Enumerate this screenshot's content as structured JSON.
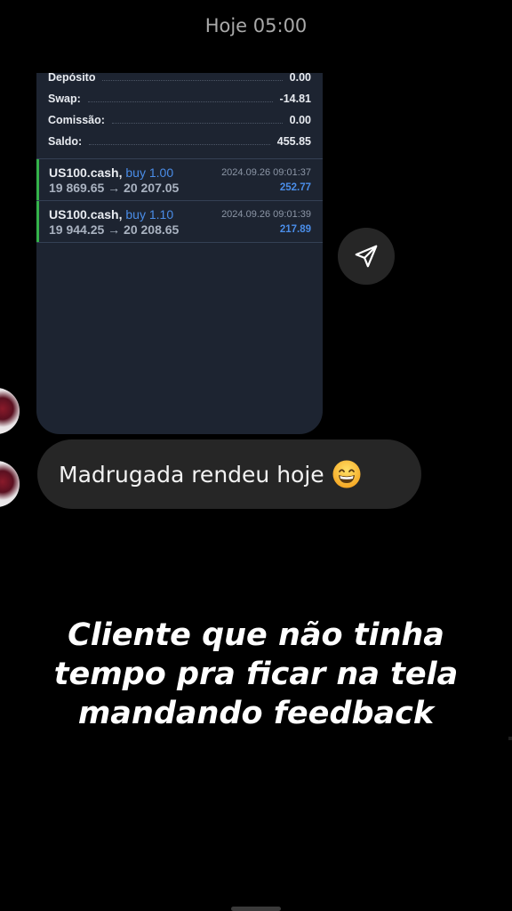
{
  "chat": {
    "timestamp": "Hoje 05:00",
    "message_text": "Madrugada rendeu hoje",
    "message_emoji": "grinning-face-with-smiling-eyes"
  },
  "screenshot": {
    "summary": [
      {
        "label": "Depósito",
        "value": "0.00"
      },
      {
        "label": "Swap:",
        "value": "-14.81"
      },
      {
        "label": "Comissão:",
        "value": "0.00"
      },
      {
        "label": "Saldo:",
        "value": "455.85"
      }
    ],
    "trades": [
      {
        "symbol": "US100.cash,",
        "side": "buy 1.00",
        "prices": "19 869.65 → 20 207.05",
        "datetime": "2024.09.26 09:01:37",
        "profit": "252.77"
      },
      {
        "symbol": "US100.cash,",
        "side": "buy 1.10",
        "prices": "19 944.25 → 20 208.65",
        "datetime": "2024.09.26 09:01:39",
        "profit": "217.89"
      }
    ]
  },
  "caption": {
    "line1": "Cliente que não tinha",
    "line2": "tempo pra ficar na tela",
    "line3": "mandando feedback"
  },
  "icons": {
    "share": "paper-plane-icon"
  },
  "colors": {
    "background": "#000000",
    "card": "#1d2431",
    "bubble": "#262626",
    "trade_bar": "#34b24a",
    "accent_blue": "#4a8de8"
  }
}
